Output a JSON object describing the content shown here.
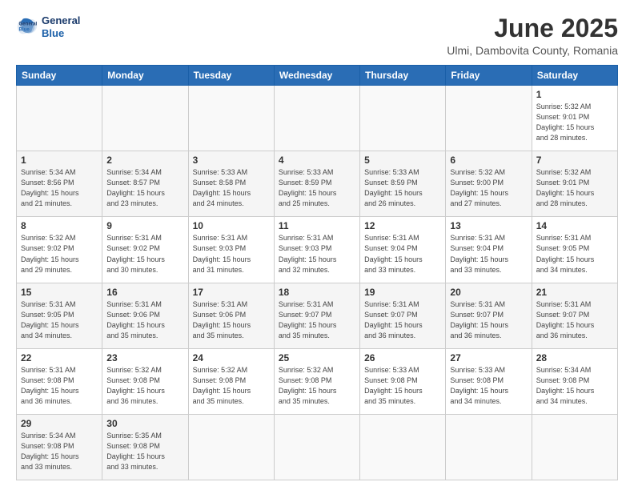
{
  "header": {
    "logo_line1": "General",
    "logo_line2": "Blue",
    "title": "June 2025",
    "subtitle": "Ulmi, Dambovita County, Romania"
  },
  "calendar": {
    "days_of_week": [
      "Sunday",
      "Monday",
      "Tuesday",
      "Wednesday",
      "Thursday",
      "Friday",
      "Saturday"
    ],
    "weeks": [
      [
        {
          "num": "",
          "empty": true
        },
        {
          "num": "",
          "empty": true
        },
        {
          "num": "",
          "empty": true
        },
        {
          "num": "",
          "empty": true
        },
        {
          "num": "",
          "empty": true
        },
        {
          "num": "",
          "empty": true
        },
        {
          "num": "1",
          "info": "Sunrise: 5:32 AM\nSunset: 9:01 PM\nDaylight: 15 hours\nand 28 minutes."
        }
      ],
      [
        {
          "num": "1",
          "info": "Sunrise: 5:34 AM\nSunset: 8:56 PM\nDaylight: 15 hours\nand 21 minutes."
        },
        {
          "num": "2",
          "info": "Sunrise: 5:34 AM\nSunset: 8:57 PM\nDaylight: 15 hours\nand 23 minutes."
        },
        {
          "num": "3",
          "info": "Sunrise: 5:33 AM\nSunset: 8:58 PM\nDaylight: 15 hours\nand 24 minutes."
        },
        {
          "num": "4",
          "info": "Sunrise: 5:33 AM\nSunset: 8:59 PM\nDaylight: 15 hours\nand 25 minutes."
        },
        {
          "num": "5",
          "info": "Sunrise: 5:33 AM\nSunset: 8:59 PM\nDaylight: 15 hours\nand 26 minutes."
        },
        {
          "num": "6",
          "info": "Sunrise: 5:32 AM\nSunset: 9:00 PM\nDaylight: 15 hours\nand 27 minutes."
        },
        {
          "num": "7",
          "info": "Sunrise: 5:32 AM\nSunset: 9:01 PM\nDaylight: 15 hours\nand 28 minutes."
        }
      ],
      [
        {
          "num": "8",
          "info": "Sunrise: 5:32 AM\nSunset: 9:02 PM\nDaylight: 15 hours\nand 29 minutes."
        },
        {
          "num": "9",
          "info": "Sunrise: 5:31 AM\nSunset: 9:02 PM\nDaylight: 15 hours\nand 30 minutes."
        },
        {
          "num": "10",
          "info": "Sunrise: 5:31 AM\nSunset: 9:03 PM\nDaylight: 15 hours\nand 31 minutes."
        },
        {
          "num": "11",
          "info": "Sunrise: 5:31 AM\nSunset: 9:03 PM\nDaylight: 15 hours\nand 32 minutes."
        },
        {
          "num": "12",
          "info": "Sunrise: 5:31 AM\nSunset: 9:04 PM\nDaylight: 15 hours\nand 33 minutes."
        },
        {
          "num": "13",
          "info": "Sunrise: 5:31 AM\nSunset: 9:04 PM\nDaylight: 15 hours\nand 33 minutes."
        },
        {
          "num": "14",
          "info": "Sunrise: 5:31 AM\nSunset: 9:05 PM\nDaylight: 15 hours\nand 34 minutes."
        }
      ],
      [
        {
          "num": "15",
          "info": "Sunrise: 5:31 AM\nSunset: 9:05 PM\nDaylight: 15 hours\nand 34 minutes."
        },
        {
          "num": "16",
          "info": "Sunrise: 5:31 AM\nSunset: 9:06 PM\nDaylight: 15 hours\nand 35 minutes."
        },
        {
          "num": "17",
          "info": "Sunrise: 5:31 AM\nSunset: 9:06 PM\nDaylight: 15 hours\nand 35 minutes."
        },
        {
          "num": "18",
          "info": "Sunrise: 5:31 AM\nSunset: 9:07 PM\nDaylight: 15 hours\nand 35 minutes."
        },
        {
          "num": "19",
          "info": "Sunrise: 5:31 AM\nSunset: 9:07 PM\nDaylight: 15 hours\nand 36 minutes."
        },
        {
          "num": "20",
          "info": "Sunrise: 5:31 AM\nSunset: 9:07 PM\nDaylight: 15 hours\nand 36 minutes."
        },
        {
          "num": "21",
          "info": "Sunrise: 5:31 AM\nSunset: 9:07 PM\nDaylight: 15 hours\nand 36 minutes."
        }
      ],
      [
        {
          "num": "22",
          "info": "Sunrise: 5:31 AM\nSunset: 9:08 PM\nDaylight: 15 hours\nand 36 minutes."
        },
        {
          "num": "23",
          "info": "Sunrise: 5:32 AM\nSunset: 9:08 PM\nDaylight: 15 hours\nand 36 minutes."
        },
        {
          "num": "24",
          "info": "Sunrise: 5:32 AM\nSunset: 9:08 PM\nDaylight: 15 hours\nand 35 minutes."
        },
        {
          "num": "25",
          "info": "Sunrise: 5:32 AM\nSunset: 9:08 PM\nDaylight: 15 hours\nand 35 minutes."
        },
        {
          "num": "26",
          "info": "Sunrise: 5:33 AM\nSunset: 9:08 PM\nDaylight: 15 hours\nand 35 minutes."
        },
        {
          "num": "27",
          "info": "Sunrise: 5:33 AM\nSunset: 9:08 PM\nDaylight: 15 hours\nand 34 minutes."
        },
        {
          "num": "28",
          "info": "Sunrise: 5:34 AM\nSunset: 9:08 PM\nDaylight: 15 hours\nand 34 minutes."
        }
      ],
      [
        {
          "num": "29",
          "info": "Sunrise: 5:34 AM\nSunset: 9:08 PM\nDaylight: 15 hours\nand 33 minutes."
        },
        {
          "num": "30",
          "info": "Sunrise: 5:35 AM\nSunset: 9:08 PM\nDaylight: 15 hours\nand 33 minutes."
        },
        {
          "num": "",
          "empty": true
        },
        {
          "num": "",
          "empty": true
        },
        {
          "num": "",
          "empty": true
        },
        {
          "num": "",
          "empty": true
        },
        {
          "num": "",
          "empty": true
        }
      ]
    ]
  }
}
